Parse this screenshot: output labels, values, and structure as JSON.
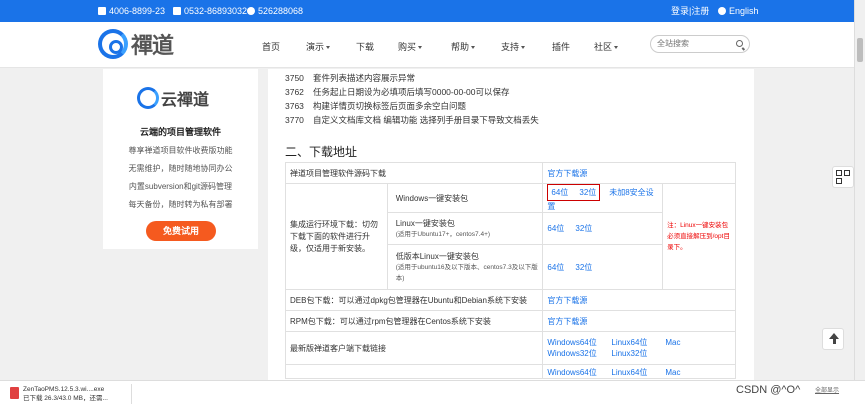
{
  "topbar": {
    "phone1": "4006-8899-23",
    "phone2": "0532-86893032",
    "qq": "526288068",
    "login": "登录|注册",
    "lang": "English"
  },
  "brand": {
    "logo_text": "禪道"
  },
  "nav": {
    "items": [
      {
        "label": "首页",
        "dropdown": false
      },
      {
        "label": "演示",
        "dropdown": true
      },
      {
        "label": "下载",
        "dropdown": false
      },
      {
        "label": "购买",
        "dropdown": true
      },
      {
        "label": "帮助",
        "dropdown": true
      },
      {
        "label": "支持",
        "dropdown": true
      },
      {
        "label": "插件",
        "dropdown": false
      },
      {
        "label": "社区",
        "dropdown": true
      }
    ],
    "search_placeholder": "全站搜索"
  },
  "sidebar": {
    "logo_text": "云禪道",
    "title": "云端的项目管理软件",
    "lines": [
      "尊享禅道项目软件收费版功能",
      "无需维护，随时随地协同办公",
      "内置subversion和git源码管理",
      "每天备份，随时转为私有部署"
    ],
    "button": "免费试用"
  },
  "bugs": [
    {
      "id": "3750",
      "text": "套件列表描述内容展示异常"
    },
    {
      "id": "3762",
      "text": "任务起止日期设为必填项后填写0000-00-00可以保存"
    },
    {
      "id": "3763",
      "text": "构建详情页切换标签后页面多余空白问题"
    },
    {
      "id": "3770",
      "text": "自定义文档库文档 编辑功能 选择列手册目录下导致文档丢失"
    }
  ],
  "section_title": "二、下载地址",
  "table": {
    "source_label": "禅道项目管理软件源码下载",
    "source_link": "官方下载源",
    "integrated_label": "集成运行环境下载：切勿下载下面的软件进行升级，仅适用于新安装。",
    "win_label": "Windows一键安装包",
    "link_64": "64位",
    "link_32": "32位",
    "win_extra": "未加8安全设置",
    "linux_label": "Linux一键安装包",
    "linux_sub": "(适用于Ubuntu17+，centos7.4+)",
    "linux_low_label": "低版本Linux一键安装包",
    "linux_low_sub": "(适用于ubuntu16及以下版本、centos7.3及以下版本)",
    "linux_note": "注：Linux一键安装包必须直接解压到/opt目录下。",
    "deb_label": "DEB包下载：可以通过dpkg包管理器在Ubuntu和Debian系统下安装",
    "deb_link": "官方下载源",
    "rpm_label": "RPM包下载：可以通过rpm包管理器在Centos系统下安装",
    "rpm_link": "官方下载源",
    "client_label": "最新版禅道客户端下载链接",
    "client_links": [
      "Windows64位",
      "Linux64位",
      "Mac",
      "Windows32位",
      "Linux32位"
    ],
    "next_row_links": [
      "Windows64位",
      "Linux64位",
      "Mac"
    ]
  },
  "download_bar": {
    "filename": "ZenTaoPMS.12.5.3.wi....exe",
    "progress": "已下载 26.3/43.0 MB，还需..."
  },
  "watermark": "CSDN @^O^",
  "watermark_extra": "全部显示"
}
